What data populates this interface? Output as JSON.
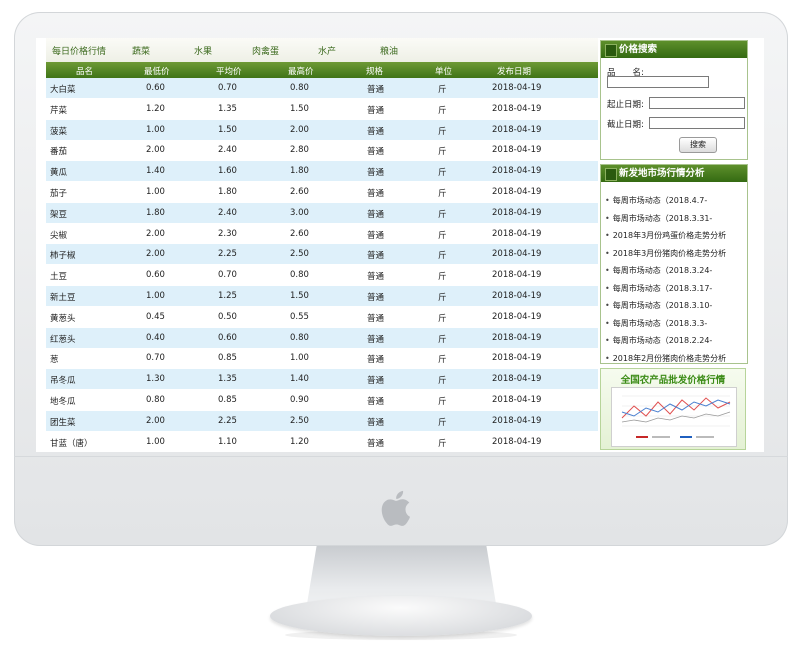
{
  "nav": {
    "title": "每日价格行情",
    "categories": [
      "蔬菜",
      "水果",
      "肉禽蛋",
      "水产",
      "粮油"
    ]
  },
  "table": {
    "headers": [
      "品名",
      "最低价",
      "平均价",
      "最高价",
      "规格",
      "单位",
      "发布日期"
    ],
    "rows": [
      [
        "大白菜",
        "0.60",
        "0.70",
        "0.80",
        "普通",
        "斤",
        "2018-04-19"
      ],
      [
        "芹菜",
        "1.20",
        "1.35",
        "1.50",
        "普通",
        "斤",
        "2018-04-19"
      ],
      [
        "菠菜",
        "1.00",
        "1.50",
        "2.00",
        "普通",
        "斤",
        "2018-04-19"
      ],
      [
        "番茄",
        "2.00",
        "2.40",
        "2.80",
        "普通",
        "斤",
        "2018-04-19"
      ],
      [
        "黄瓜",
        "1.40",
        "1.60",
        "1.80",
        "普通",
        "斤",
        "2018-04-19"
      ],
      [
        "茄子",
        "1.00",
        "1.80",
        "2.60",
        "普通",
        "斤",
        "2018-04-19"
      ],
      [
        "架豆",
        "1.80",
        "2.40",
        "3.00",
        "普通",
        "斤",
        "2018-04-19"
      ],
      [
        "尖椒",
        "2.00",
        "2.30",
        "2.60",
        "普通",
        "斤",
        "2018-04-19"
      ],
      [
        "柿子椒",
        "2.00",
        "2.25",
        "2.50",
        "普通",
        "斤",
        "2018-04-19"
      ],
      [
        "土豆",
        "0.60",
        "0.70",
        "0.80",
        "普通",
        "斤",
        "2018-04-19"
      ],
      [
        "新土豆",
        "1.00",
        "1.25",
        "1.50",
        "普通",
        "斤",
        "2018-04-19"
      ],
      [
        "黄葱头",
        "0.45",
        "0.50",
        "0.55",
        "普通",
        "斤",
        "2018-04-19"
      ],
      [
        "红葱头",
        "0.40",
        "0.60",
        "0.80",
        "普通",
        "斤",
        "2018-04-19"
      ],
      [
        "葱",
        "0.70",
        "0.85",
        "1.00",
        "普通",
        "斤",
        "2018-04-19"
      ],
      [
        "吊冬瓜",
        "1.30",
        "1.35",
        "1.40",
        "普通",
        "斤",
        "2018-04-19"
      ],
      [
        "地冬瓜",
        "0.80",
        "0.85",
        "0.90",
        "普通",
        "斤",
        "2018-04-19"
      ],
      [
        "团生菜",
        "2.00",
        "2.25",
        "2.50",
        "普通",
        "斤",
        "2018-04-19"
      ],
      [
        "甘蓝（唐）",
        "1.00",
        "1.10",
        "1.20",
        "普通",
        "斤",
        "2018-04-19"
      ]
    ]
  },
  "search": {
    "title": "价格搜索",
    "name_label": "品　　名:",
    "start_label": "起止日期:",
    "end_label": "截止日期:",
    "button_label": "搜索"
  },
  "news": {
    "title": "新发地市场行情分析",
    "items": [
      "每周市场动态（2018.4.7-",
      "每周市场动态（2018.3.31-",
      "2018年3月份鸡蛋价格走势分析",
      "2018年3月份猪肉价格走势分析",
      "每周市场动态（2018.3.24-",
      "每周市场动态（2018.3.17-",
      "每周市场动态（2018.3.10-",
      "每周市场动态（2018.3.3-",
      "每周市场动态（2018.2.24-",
      "2018年2月份猪肉价格走势分析"
    ]
  },
  "banner": {
    "title": "全国农产品批发价格行情"
  },
  "colors": {
    "header_green": "#4f8424",
    "row_alt_blue": "#def0fa",
    "link_green": "#3c6a1e",
    "banner_title_green": "#3c8c17"
  },
  "icons": {
    "brand_logo": "apple-logo-icon",
    "box_title_marker": "square-bullet-icon"
  }
}
